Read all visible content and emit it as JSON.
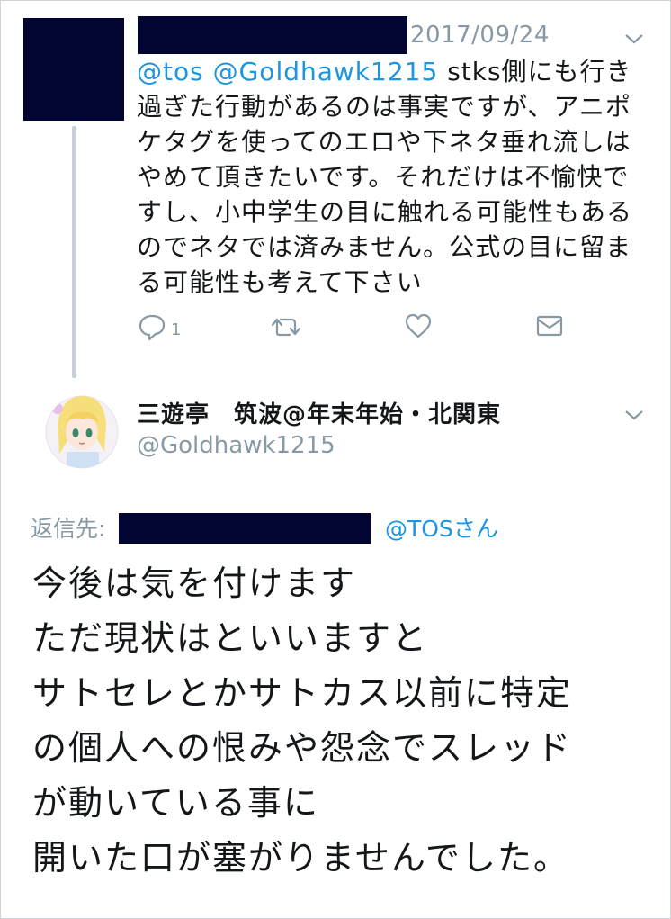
{
  "top_tweet": {
    "date": "2017/09/24",
    "mentions": [
      "@tos",
      "@Goldhawk1215"
    ],
    "text": "stks側にも行き過ぎた行動があるのは事実ですが、アニポケタグを使ってのエロや下ネタ垂れ流しはやめて頂きたいです。それだけは不愉快ですし、小中学生の目に触れる可能性もあるのでネタでは済みません。公式の目に留まる可能性も考えて下さい",
    "actions": {
      "reply_icon": "reply-icon",
      "reply_count": "1",
      "retweet_icon": "retweet-icon",
      "like_icon": "heart-icon",
      "dm_icon": "envelope-icon"
    },
    "menu_icon": "chevron-down-icon"
  },
  "main_tweet": {
    "display_name": "三遊亭　筑波@年末年始・北関東",
    "handle": "@Goldhawk1215",
    "reply_to_label": "返信先:",
    "reply_to_handle": "@TOSさん",
    "lines": [
      "今後は気を付けます",
      "ただ現状はといいますと",
      "サトセレとかサトカス以前に特定",
      "の個人への恨みや怨念でスレッド",
      "が動いている事に",
      "開いた口が塞がりませんでした。"
    ],
    "menu_icon": "chevron-down-icon"
  },
  "colors": {
    "link": "#1b95e0",
    "muted": "#8899a6",
    "text": "#14171a",
    "redaction": "#020431",
    "thread_line": "#c9d1d8"
  }
}
